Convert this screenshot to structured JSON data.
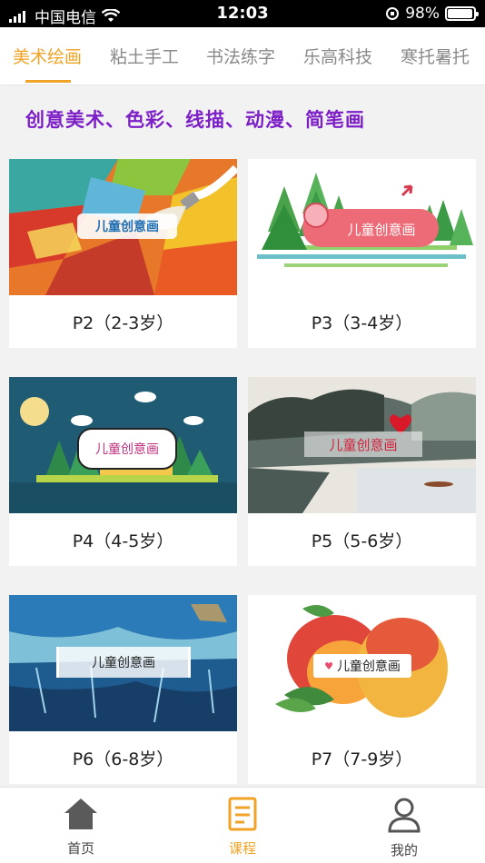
{
  "status": {
    "carrier": "中国电信",
    "time": "12:03",
    "battery": "98%",
    "battery_level": 0.98
  },
  "tabs": [
    {
      "label": "美术绘画",
      "active": true
    },
    {
      "label": "粘土手工",
      "active": false
    },
    {
      "label": "书法练字",
      "active": false
    },
    {
      "label": "乐高科技",
      "active": false
    },
    {
      "label": "寒托暑托",
      "active": false
    }
  ],
  "headline": "创意美术、色彩、线描、动漫、简笔画",
  "courses": [
    {
      "title": "P2（2-3岁）",
      "banner": "儿童创意画"
    },
    {
      "title": "P3（3-4岁）",
      "banner": "儿童创意画"
    },
    {
      "title": "P4（4-5岁）",
      "banner": "儿童创意画"
    },
    {
      "title": "P5（5-6岁）",
      "banner": "儿童创意画"
    },
    {
      "title": "P6（6-8岁）",
      "banner": "儿童创意画"
    },
    {
      "title": "P7（7-9岁）",
      "banner": "儿童创意画"
    }
  ],
  "bottom_nav": [
    {
      "label": "首页",
      "icon": "home-icon",
      "active": false
    },
    {
      "label": "课程",
      "icon": "book-icon",
      "active": true
    },
    {
      "label": "我的",
      "icon": "user-icon",
      "active": false
    }
  ],
  "colors": {
    "accent": "#f0a326",
    "headline": "#7c1fc7"
  }
}
